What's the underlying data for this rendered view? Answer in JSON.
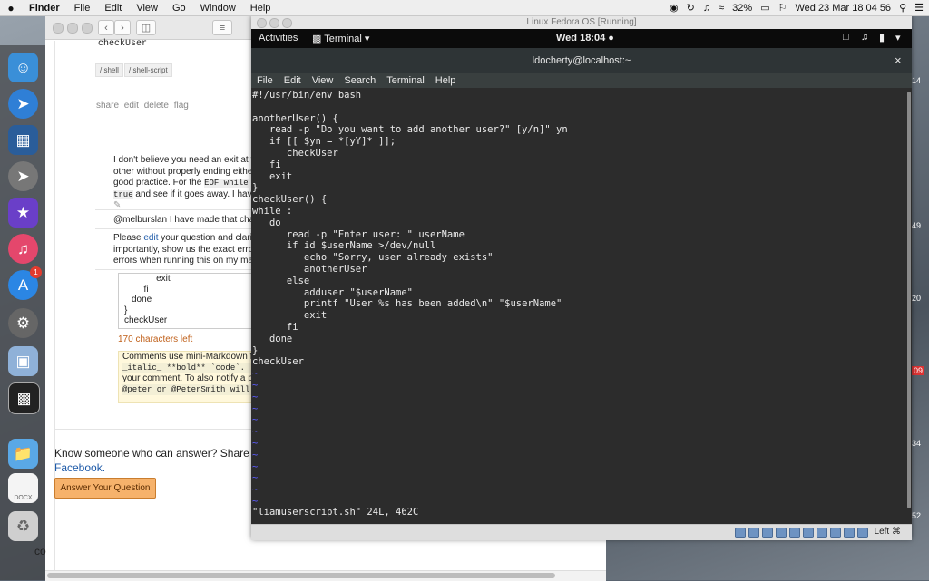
{
  "menubar": {
    "apple": "",
    "items": [
      "Finder",
      "File",
      "Edit",
      "View",
      "Go",
      "Window",
      "Help"
    ],
    "battery": "32%",
    "datetime": "Wed 23 Mar  18 04 56"
  },
  "dock": {
    "icons": [
      "finder-icon",
      "safari-icon",
      "virtualbox-icon",
      "launchpad-icon",
      "imovie-icon",
      "itunes-icon",
      "app-store-icon",
      "system-preferences-icon",
      "preview-icon",
      "screen-icon",
      "folder-icon",
      "docx-icon",
      "trash-icon"
    ],
    "app_store_badge": "1",
    "docx_label": "DOCX"
  },
  "browser": {
    "question_title": "checkUser",
    "tags": [
      "/ shell",
      "/ shell-script"
    ],
    "post_links": "share edit delete flag",
    "comment1": [
      "I don't believe you need an exit at the",
      "other without properly ending either",
      "good practice. For the",
      "and see if it goes away. I have"
    ],
    "comment1_code1": "EOF while",
    "comment1_code2": "true",
    "comment2": "@melburslan I have made that change",
    "comment3_pre": "Please ",
    "comment3_link": "edit",
    "comment3_post": " your question and clarify.",
    "comment3_lines": [
      "importantly, show us the exact error",
      "errors when running this on my mach"
    ],
    "textarea_lines": [
      "    exit",
      "  fi",
      "done",
      "}",
      "checkUser"
    ],
    "chars_left": "170 characters left",
    "help_lines": [
      "Comments use mini-Markdown for",
      "_italic_ **bold** `code`.",
      "your comment. To also notify a pre",
      "@peter or @PeterSmith will"
    ],
    "share_text": "Know someone who can answer? Share a",
    "facebook": "Facebook.",
    "answer_button": "Answer Your Question",
    "cut_text": "co"
  },
  "vbox": {
    "title": "Linux Fedora OS  [Running]",
    "activities": "Activities",
    "terminal_menu": "Terminal",
    "clock": "Wed 18:04",
    "term_title": "ldocherty@localhost:~",
    "term_menu": [
      "File",
      "Edit",
      "View",
      "Search",
      "Terminal",
      "Help"
    ],
    "lines": [
      "#!/usr/bin/env bash",
      "",
      "anotherUser() {",
      "   read -p \"Do you want to add another user?\" [y/n]\" yn",
      "   if [[ $yn = *[yY]* ]];",
      "      checkUser",
      "   fi",
      "   exit",
      "}",
      "checkUser() {",
      "while :",
      "   do",
      "      read -p \"Enter user: \" userName",
      "      if id $userName >/dev/null",
      "         echo \"Sorry, user already exists\"",
      "         anotherUser",
      "      else",
      "         adduser \"$userName\"",
      "         printf \"User %s has been added\\n\" \"$userName\"",
      "         exit",
      "      fi",
      "   done",
      "}",
      "checkUser"
    ],
    "tilde_count": 12,
    "tilde_char": "~",
    "status_line": "\"liamuserscript.sh\" 24L, 462C",
    "host_key": "Left ⌘"
  },
  "desktop_labels": [
    "14",
    "49",
    "20",
    "09",
    "34",
    "52"
  ]
}
